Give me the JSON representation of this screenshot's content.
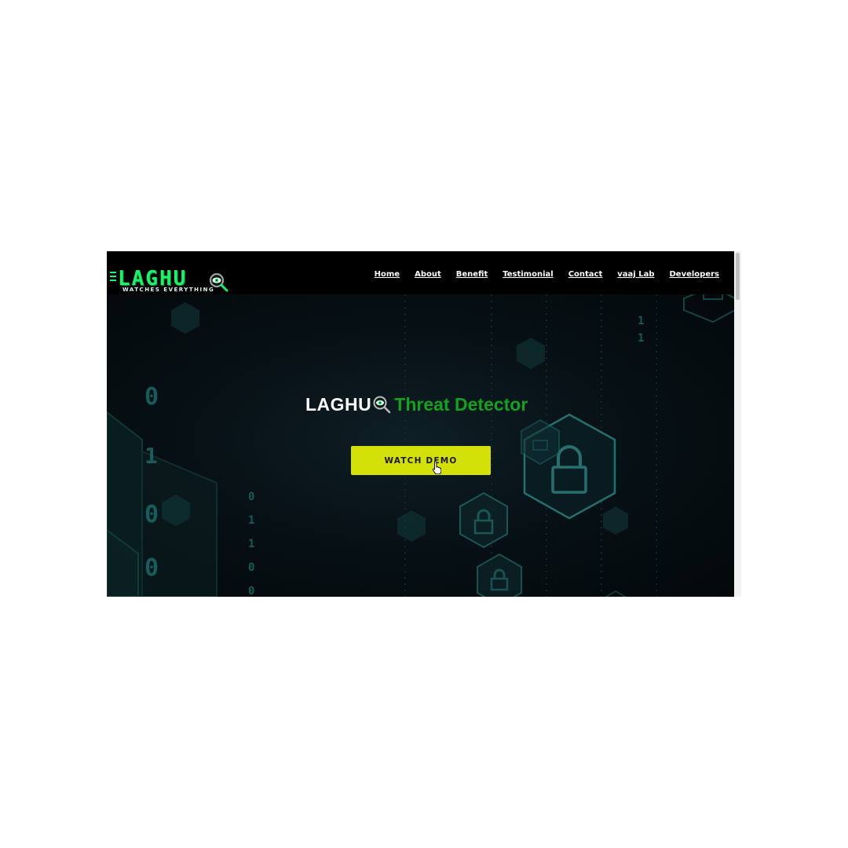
{
  "brand": {
    "logo_word": "LAGHU",
    "logo_tagline": "WATCHES EVERYTHING"
  },
  "nav": {
    "items": [
      {
        "label": "Home"
      },
      {
        "label": "About"
      },
      {
        "label": "Benefit"
      },
      {
        "label": "Testimonial"
      },
      {
        "label": "Contact"
      },
      {
        "label": "vaaj Lab"
      },
      {
        "label": "Developers"
      }
    ]
  },
  "hero": {
    "title_brand": "LAGHU",
    "title_accent": "Threat Detector",
    "cta_label": "WATCH DEMO",
    "background_motif": "lock-hexagon-icon"
  },
  "icons": {
    "logo_eye": "eye-magnifier-icon",
    "cursor": "hand-pointer-icon"
  },
  "colors": {
    "navbar_bg": "#000000",
    "hero_bg": "#071116",
    "accent_green": "#15a021",
    "logo_green": "#1ff06a",
    "cta_yellow": "#d4e109",
    "motif_teal": "#1f6b6b"
  }
}
